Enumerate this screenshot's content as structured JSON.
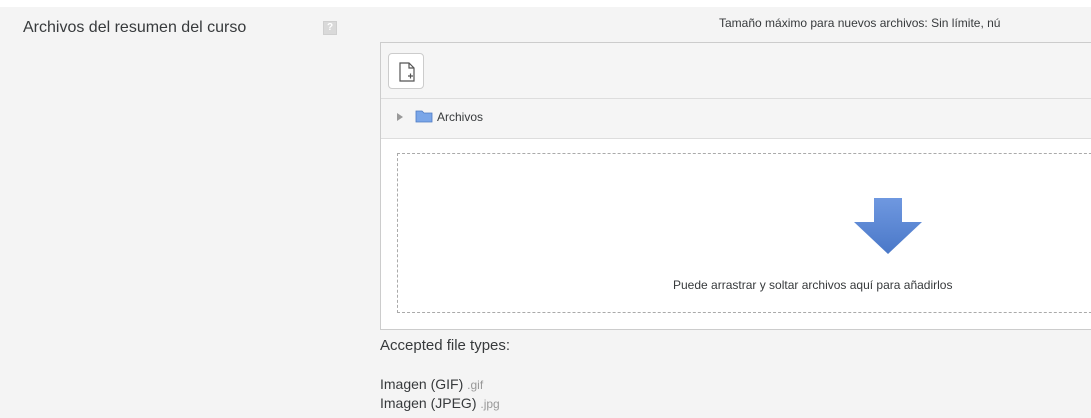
{
  "field": {
    "label": "Archivos del resumen del curso",
    "help_glyph": "?"
  },
  "filemanager": {
    "max_size_text": "Tamaño máximo para nuevos archivos: Sin límite, nú",
    "path_folder": "Archivos",
    "drop_text": "Puede arrastrar y soltar archivos aquí para añadirlos",
    "add_file_icon": "file-add-icon",
    "folder_icon": "folder-icon",
    "drop_icon": "arrow-down-icon"
  },
  "accepted": {
    "title": "Accepted file types:",
    "types": [
      {
        "name": "Imagen (GIF)",
        "ext": ".gif"
      },
      {
        "name": "Imagen (JPEG)",
        "ext": ".jpg"
      }
    ]
  },
  "colors": {
    "background": "#f4f4f4",
    "panel_border": "#cccccc",
    "arrow_fill": "#5b86d6",
    "folder_fill": "#7aa6e8",
    "muted_text": "#999999"
  }
}
